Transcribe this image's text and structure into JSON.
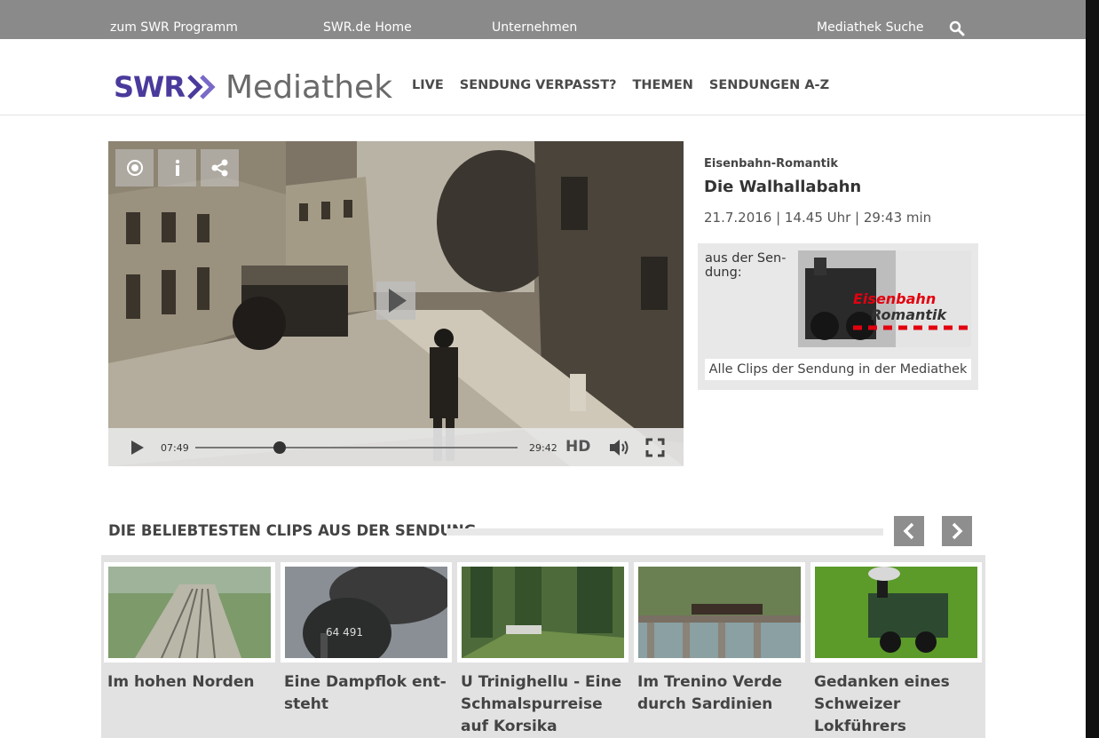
{
  "topbar": {
    "links": [
      "zum SWR Programm",
      "SWR.de Home",
      "Unternehmen"
    ],
    "search_label": "Mediathek Suche",
    "search_icon": "search-icon"
  },
  "header": {
    "logo_brand": "SWR",
    "logo_text": "Mediathek",
    "nav": [
      "LIVE",
      "SENDUNG VERPASST?",
      "THEMEN",
      "SENDUNGEN A-Z"
    ]
  },
  "player": {
    "top_controls": [
      "contrast-icon",
      "info-icon",
      "share-icon"
    ],
    "current_time": "07:49",
    "duration": "29:42",
    "progress": 0.263,
    "hd_label": "HD",
    "controls": [
      "play-icon",
      "volume-icon",
      "fullscreen-icon"
    ]
  },
  "info": {
    "kicker": "Eisenbahn-Romantik",
    "title": "Die Walhallabahn",
    "meta": "21.7.2016 | 14.45 Uhr | 29:43 min",
    "show_label": "aus der Sen-dung:",
    "show_logo_line1": "Eisenbahn",
    "show_logo_line2": "Romantik",
    "show_link": "Alle Clips der Sendung in der Mediathek"
  },
  "clips": {
    "section_title": "DIE BELIEBTESTEN CLIPS AUS DER SENDUNG",
    "items": [
      {
        "title": "Im hohen Norden"
      },
      {
        "title": "Eine Dampflok ent-steht",
        "badge": "64 491"
      },
      {
        "title": "U Trinighellu - Eine Schmalspurreise auf Korsika"
      },
      {
        "title": "Im Trenino Verde durch Sardinien"
      },
      {
        "title": "Gedanken eines Schweizer Lokführers"
      }
    ]
  },
  "colors": {
    "topbar": "#8a8a8a",
    "brand_purple": "#4b3a9c",
    "brand_red": "#e3000f"
  }
}
